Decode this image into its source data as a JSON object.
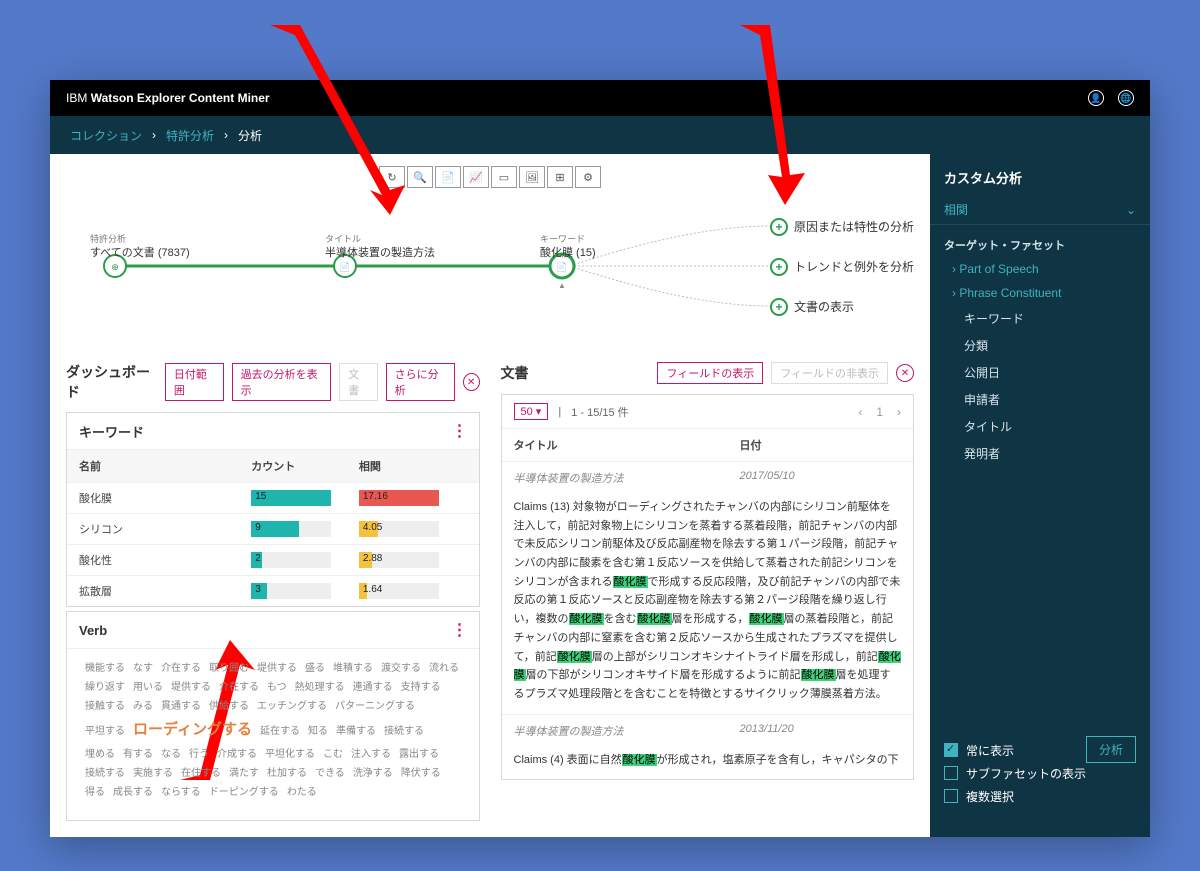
{
  "header": {
    "product_prefix": "IBM",
    "product_name": "Watson Explorer Content Miner"
  },
  "breadcrumb": {
    "item1": "コレクション",
    "item2": "特許分析",
    "item3": "分析"
  },
  "flow": {
    "node1_small": "特許分析",
    "node1_label": "すべての文書 (7837)",
    "node2_small": "タイトル",
    "node2_label": "半導体装置の製造方法",
    "node3_small": "キーワード",
    "node3_label": "酸化膜 (15)",
    "branch1": "原因または特性の分析",
    "branch2": "トレンドと例外を分析",
    "branch3": "文書の表示"
  },
  "dashboard": {
    "title": "ダッシュボード",
    "btn_date": "日付範囲",
    "btn_history": "過去の分析を表示",
    "btn_doc": "文書",
    "btn_more": "さらに分析"
  },
  "keywords": {
    "title": "キーワード",
    "col_name": "名前",
    "col_count": "カウント",
    "col_corr": "相関",
    "rows": [
      {
        "name": "酸化膜",
        "count": "15",
        "corr": "17.16"
      },
      {
        "name": "シリコン",
        "count": "9",
        "corr": "4.05"
      },
      {
        "name": "酸化性",
        "count": "2",
        "corr": "2.88"
      },
      {
        "name": "拡散層",
        "count": "3",
        "corr": "1.64"
      }
    ]
  },
  "verb": {
    "title": "Verb",
    "highlight": "ローディングする",
    "words": [
      "機能する",
      "なす",
      "介在する",
      "取り囲む",
      "堤供する",
      "盛る",
      "堆積する",
      "渡交する",
      "流れる",
      "繰り返す",
      "用いる",
      "堤供する",
      "介在する",
      "もつ",
      "熱処理する",
      "連通する",
      "支持する",
      "接触する",
      "みる",
      "貫通する",
      "供給する",
      "エッチングする",
      "パターニングする",
      "平坦する",
      "延在する",
      "知る",
      "準備する",
      "接続する",
      "埋める",
      "有する",
      "なる",
      "行う",
      "介成する",
      "平坦化する",
      "こむ",
      "注入する",
      "露出する",
      "接続する",
      "実施する",
      "在住する",
      "満たす",
      "杜加する",
      "できる",
      "洗浄する",
      "降伏する",
      "得る",
      "成長する",
      "ならする",
      "ドーピングする",
      "わたる"
    ]
  },
  "docs": {
    "title": "文書",
    "btn_show": "フィールドの表示",
    "btn_hide": "フィールドの非表示",
    "page_size": "50",
    "page_info": "1 - 15/15 件",
    "page_num": "1",
    "col_title": "タイトル",
    "col_date": "日付",
    "row1_title": "半導体装置の製造方法",
    "row1_date": "2017/05/10",
    "row1_body": "Claims (13) 対象物がローディングされたチャンバの内部にシリコン前駆体を注入して，前記対象物上にシリコンを蒸着する蒸着段階，前記チャンバの内部で未反応シリコン前駆体及び反応副産物を除去する第１パージ段階，前記チャンバの内部に酸素を含む第１反応ソースを供給して蒸着された前記シリコンをシリコンが含まれる酸化膜で形成する反応段階，及び前記チャンバの内部で未反応の第１反応ソースと反応副産物を除去する第２パージ段階を繰り返し行い，複数の酸化膜を含む酸化膜層を形成する，酸化膜層の蒸着段階と，前記チャンバの内部に窒素を含む第２反応ソースから生成されたプラズマを提供して，前記酸化膜層の上部がシリコンオキシナイトライド層を形成し，前記酸化膜層の下部がシリコンオキサイド層を形成するように前記酸化膜層を処理するプラズマ処理段階とを含むことを特徴とするサイクリック薄膜蒸着方法。",
    "row2_title": "半導体装置の製造方法",
    "row2_date": "2013/11/20",
    "row2_body": "Claims (4) 表面に自然酸化膜が形成され，塩素原子を含有し，キャパシタの下"
  },
  "sidebar": {
    "title": "カスタム分析",
    "dropdown": "相関",
    "subhead": "ターゲット・ファセット",
    "items": {
      "pos": "Part of Speech",
      "pc": "Phrase Constituent",
      "kw": "キーワード",
      "cat": "分類",
      "pub": "公開日",
      "app": "申請者",
      "ttl": "タイトル",
      "inv": "発明者"
    },
    "chk_always": "常に表示",
    "chk_sub": "サブファセットの表示",
    "chk_multi": "複数選択",
    "analyze": "分析"
  }
}
